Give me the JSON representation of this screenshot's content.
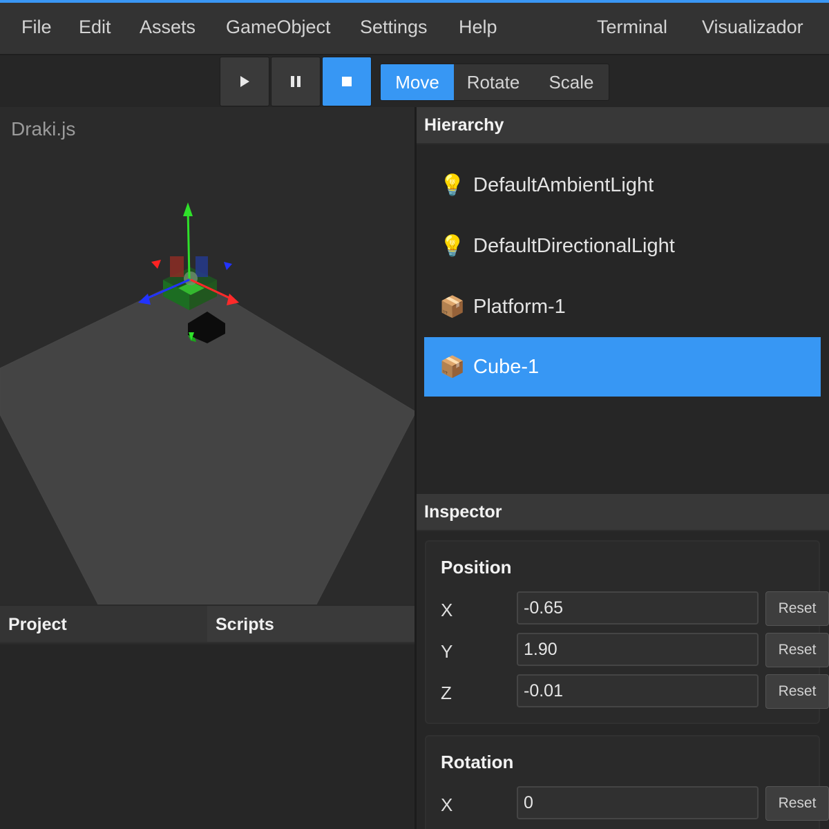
{
  "menubar": {
    "items": [
      "File",
      "Edit",
      "Assets",
      "GameObject",
      "Settings",
      "Help"
    ],
    "right_items": [
      "Terminal",
      "Visualizador"
    ]
  },
  "toolbar": {
    "play_icon": "play-icon",
    "pause_icon": "pause-icon",
    "stop_icon": "stop-icon",
    "active_control": "stop",
    "transform_modes": [
      "Move",
      "Rotate",
      "Scale"
    ],
    "active_mode": "Move"
  },
  "viewport": {
    "title": "Draki.js"
  },
  "lower_tabs": {
    "project": "Project",
    "scripts": "Scripts"
  },
  "hierarchy": {
    "title": "Hierarchy",
    "items": [
      {
        "label": "DefaultAmbientLight",
        "icon": "lightbulb-icon",
        "glyph": "💡"
      },
      {
        "label": "DefaultDirectionalLight",
        "icon": "lightbulb-icon",
        "glyph": "💡"
      },
      {
        "label": "Platform-1",
        "icon": "package-icon",
        "glyph": "📦"
      },
      {
        "label": "Cube-1",
        "icon": "package-icon",
        "glyph": "📦"
      }
    ],
    "selected": "Cube-1"
  },
  "inspector": {
    "title": "Inspector",
    "reset_label": "Reset",
    "position": {
      "title": "Position",
      "x_label": "X",
      "x": "-0.65",
      "y_label": "Y",
      "y": "1.90",
      "z_label": "Z",
      "z": "-0.01"
    },
    "rotation": {
      "title": "Rotation",
      "x_label": "X",
      "x": "0"
    }
  },
  "colors": {
    "accent": "#3797f4",
    "background": "#262626",
    "panel_header": "#383838"
  }
}
